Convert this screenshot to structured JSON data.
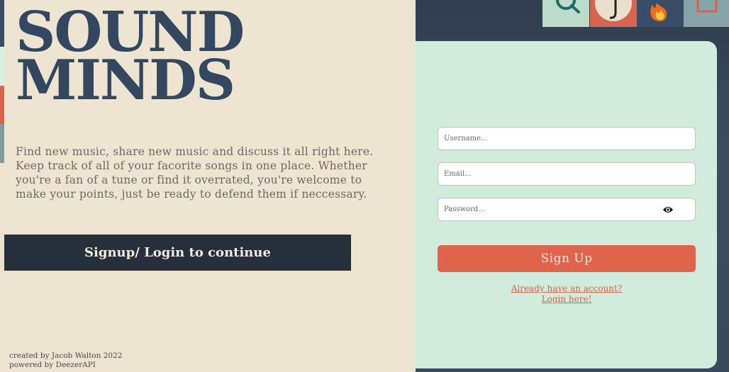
{
  "hero": {
    "brand_line1": "SOUND",
    "brand_line2": "MINDS",
    "tagline": "Find new music, share new music and discuss it all right here. Keep track of all of your facorite songs in one place. Whether you're a fan of a tune or find it overrated, you're welcome to make your points, just be ready to defend them if neccessary.",
    "cta_label": "Signup/ Login to continue"
  },
  "footer": {
    "credit_line1": "created by Jacob Walton 2022",
    "credit_line2": "powered by DeezerAPI"
  },
  "nav_tiles": [
    {
      "icon": "search-icon"
    },
    {
      "icon": "avatar-icon"
    },
    {
      "icon": "fire-icon"
    },
    {
      "icon": "square-icon"
    }
  ],
  "form": {
    "username_placeholder": "Username...",
    "email_placeholder": "Email...",
    "password_placeholder": "Password...",
    "show_password_icon": "eye-icon",
    "submit_label": "Sign Up",
    "login_line1": "Already have an account?",
    "login_line2": "Login here!"
  },
  "colors": {
    "navy": "#334760",
    "cream": "#ede4d1",
    "mint": "#d1ebdc",
    "coral": "#de654c",
    "dark": "#272f3b"
  }
}
